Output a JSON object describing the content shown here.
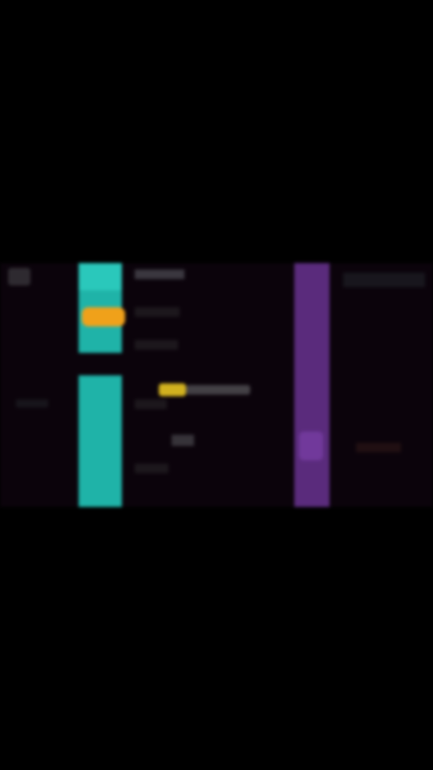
{
  "screen": {
    "background": "#000000",
    "frame_background": "#0b030b",
    "accent_cyan": "#1fb3a8",
    "accent_orange": "#f0a11a",
    "accent_purple": "#5a2b7c",
    "highlight_yellow": "#d1b11f"
  },
  "icons": {
    "corner_icon": "app-icon"
  }
}
